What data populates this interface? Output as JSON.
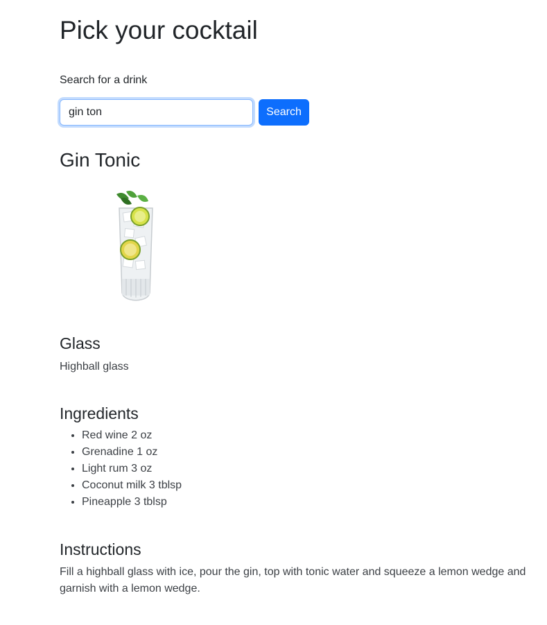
{
  "header": {
    "title": "Pick your cocktail"
  },
  "search": {
    "label": "Search for a drink",
    "value": "gin ton",
    "button_label": "Search"
  },
  "drink": {
    "name": "Gin Tonic",
    "image_alt": "gin-tonic-highball-glass",
    "glass_heading": "Glass",
    "glass": "Highball glass",
    "ingredients_heading": "Ingredients",
    "ingredients": [
      "Red wine 2 oz",
      "Grenadine 1 oz",
      "Light rum 3 oz",
      "Coconut milk 3 tblsp",
      "Pineapple 3 tblsp"
    ],
    "instructions_heading": "Instructions",
    "instructions": "Fill a highball glass with ice, pour the gin, top with tonic water and squeeze a lemon wedge and garnish with a lemon wedge."
  },
  "colors": {
    "primary": "#0d6efd",
    "text": "#212529",
    "focus_border": "#86b7fe"
  }
}
